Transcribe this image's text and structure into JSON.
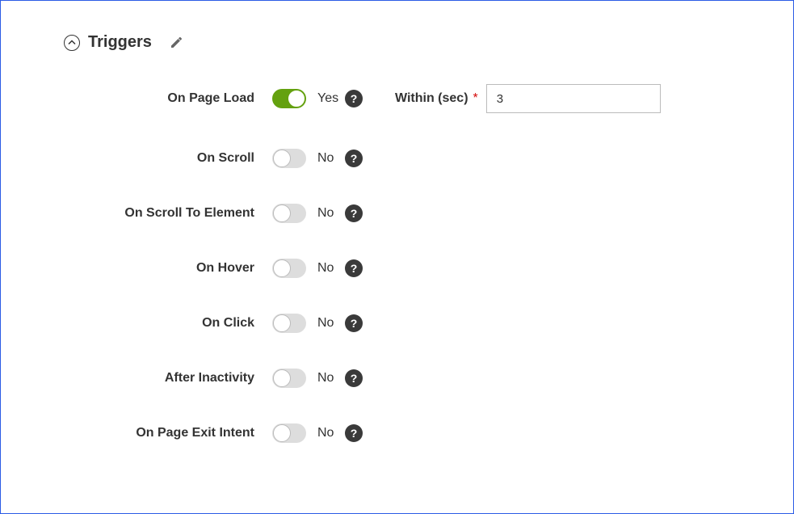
{
  "section": {
    "title": "Triggers"
  },
  "yesLabel": "Yes",
  "noLabel": "No",
  "requiredMark": "*",
  "withinField": {
    "label": "Within (sec)",
    "value": "3"
  },
  "triggers": {
    "onPageLoad": {
      "label": "On Page Load",
      "enabled": true
    },
    "onScroll": {
      "label": "On Scroll",
      "enabled": false
    },
    "onScrollToElement": {
      "label": "On Scroll To Element",
      "enabled": false
    },
    "onHover": {
      "label": "On Hover",
      "enabled": false
    },
    "onClick": {
      "label": "On Click",
      "enabled": false
    },
    "afterInactivity": {
      "label": "After Inactivity",
      "enabled": false
    },
    "onPageExitIntent": {
      "label": "On Page Exit Intent",
      "enabled": false
    }
  }
}
